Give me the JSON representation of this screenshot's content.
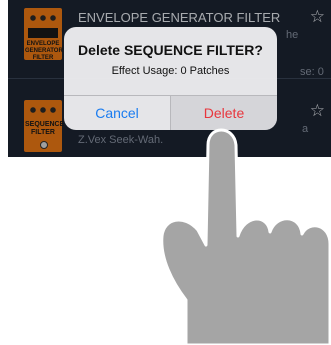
{
  "list": {
    "row1": {
      "name": "ENVELOPE GENERATOR FILTER",
      "pedal_text": "ENVELOPE GENERATOR FILTER",
      "sub_fragment": "he",
      "usage_fragment": "se: 0"
    },
    "row2": {
      "pedal_text": "SEQUENCE FILTER",
      "sub_fragment": "a",
      "description": "Z.Vex Seek-Wah."
    },
    "star_icon": "☆"
  },
  "alert": {
    "title": "Delete SEQUENCE FILTER?",
    "message": "Effect Usage: 0 Patches",
    "cancel_label": "Cancel",
    "delete_label": "Delete"
  },
  "colors": {
    "accent": "#1a7cf0",
    "destructive": "#e8363d",
    "list_bg": "#1c2432",
    "pedal": "#f07a14"
  }
}
